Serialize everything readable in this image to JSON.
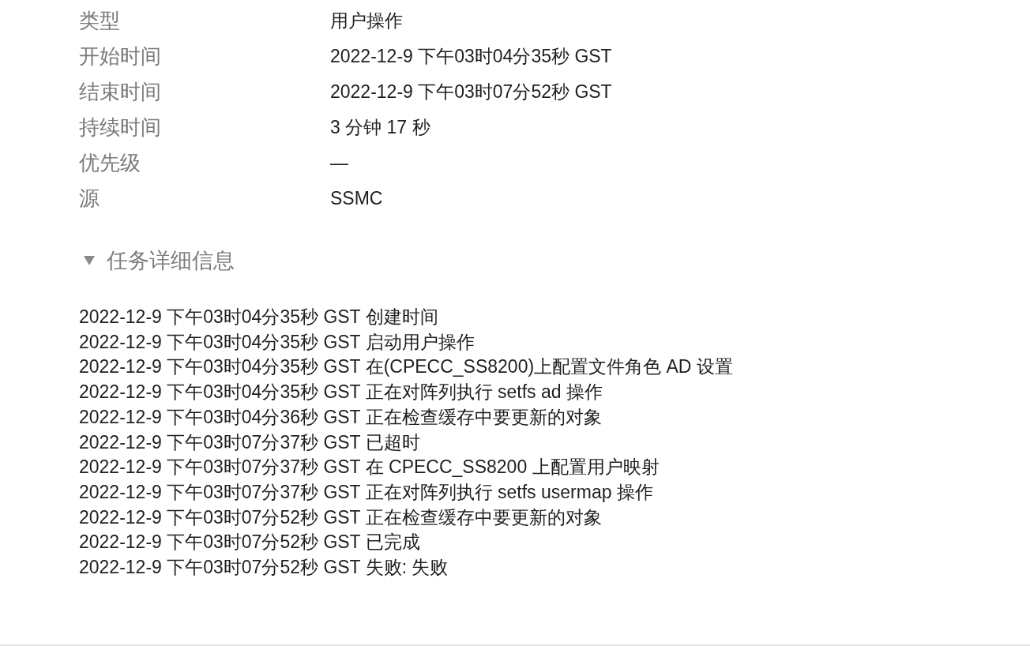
{
  "properties": [
    {
      "label": "类型",
      "value": "用户操作"
    },
    {
      "label": "开始时间",
      "value": "2022-12-9 下午03时04分35秒 GST"
    },
    {
      "label": "结束时间",
      "value": "2022-12-9 下午03时07分52秒 GST"
    },
    {
      "label": "持续时间",
      "value": "3 分钟 17 秒"
    },
    {
      "label": "优先级",
      "value": "—"
    },
    {
      "label": "源",
      "value": "SSMC"
    }
  ],
  "task_details": {
    "title": "任务详细信息",
    "expanded": true,
    "lines": [
      "2022-12-9 下午03时04分35秒 GST 创建时间",
      "2022-12-9 下午03时04分35秒 GST 启动用户操作",
      "2022-12-9 下午03时04分35秒 GST 在(CPECC_SS8200)上配置文件角色 AD 设置",
      "2022-12-9 下午03时04分35秒 GST 正在对阵列执行 setfs ad 操作",
      "2022-12-9 下午03时04分36秒 GST 正在检查缓存中要更新的对象",
      "2022-12-9 下午03时07分37秒 GST 已超时",
      "2022-12-9 下午03时07分37秒 GST 在 CPECC_SS8200 上配置用户映射",
      "2022-12-9 下午03时07分37秒 GST 正在对阵列执行 setfs usermap 操作",
      "2022-12-9 下午03时07分52秒 GST 正在检查缓存中要更新的对象",
      "2022-12-9 下午03时07分52秒 GST 已完成",
      "2022-12-9 下午03时07分52秒 GST 失败: 失败"
    ]
  }
}
